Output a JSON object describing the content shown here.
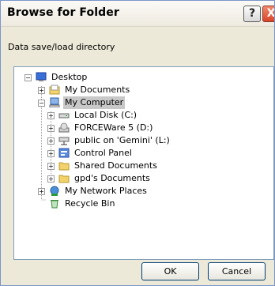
{
  "window": {
    "title": "Browse for Folder",
    "help_symbol": "?",
    "close_symbol": "X"
  },
  "prompt": "Data save/load directory",
  "tree": {
    "expanders": {
      "expanded": "−",
      "collapsed": "+"
    },
    "items": [
      {
        "label": "Desktop",
        "icon": "desktop-icon",
        "expander": "expanded"
      },
      {
        "label": "My Documents",
        "icon": "my-documents-icon",
        "expander": "collapsed"
      },
      {
        "label": "My Computer",
        "icon": "my-computer-icon",
        "expander": "expanded",
        "selected": true
      },
      {
        "label": "Local Disk (C:)",
        "icon": "local-disk-icon",
        "expander": "collapsed"
      },
      {
        "label": "FORCEWare 5 (D:)",
        "icon": "cd-drive-icon",
        "expander": "collapsed"
      },
      {
        "label": "public on 'Gemini' (L:)",
        "icon": "network-drive-icon",
        "expander": "collapsed"
      },
      {
        "label": "Control Panel",
        "icon": "control-panel-icon",
        "expander": "collapsed"
      },
      {
        "label": "Shared Documents",
        "icon": "folder-icon",
        "expander": "collapsed"
      },
      {
        "label": "gpd's Documents",
        "icon": "folder-icon",
        "expander": "collapsed"
      },
      {
        "label": "My Network Places",
        "icon": "network-places-icon",
        "expander": "collapsed"
      },
      {
        "label": "Recycle Bin",
        "icon": "recycle-bin-icon",
        "expander": "none"
      }
    ]
  },
  "buttons": {
    "ok": "OK",
    "cancel": "Cancel"
  },
  "colors": {
    "selection": "#c8c8c8",
    "frame": "#7a96c8",
    "dialog_bg": "#ece9d8",
    "tree_border": "#7f9db9"
  }
}
